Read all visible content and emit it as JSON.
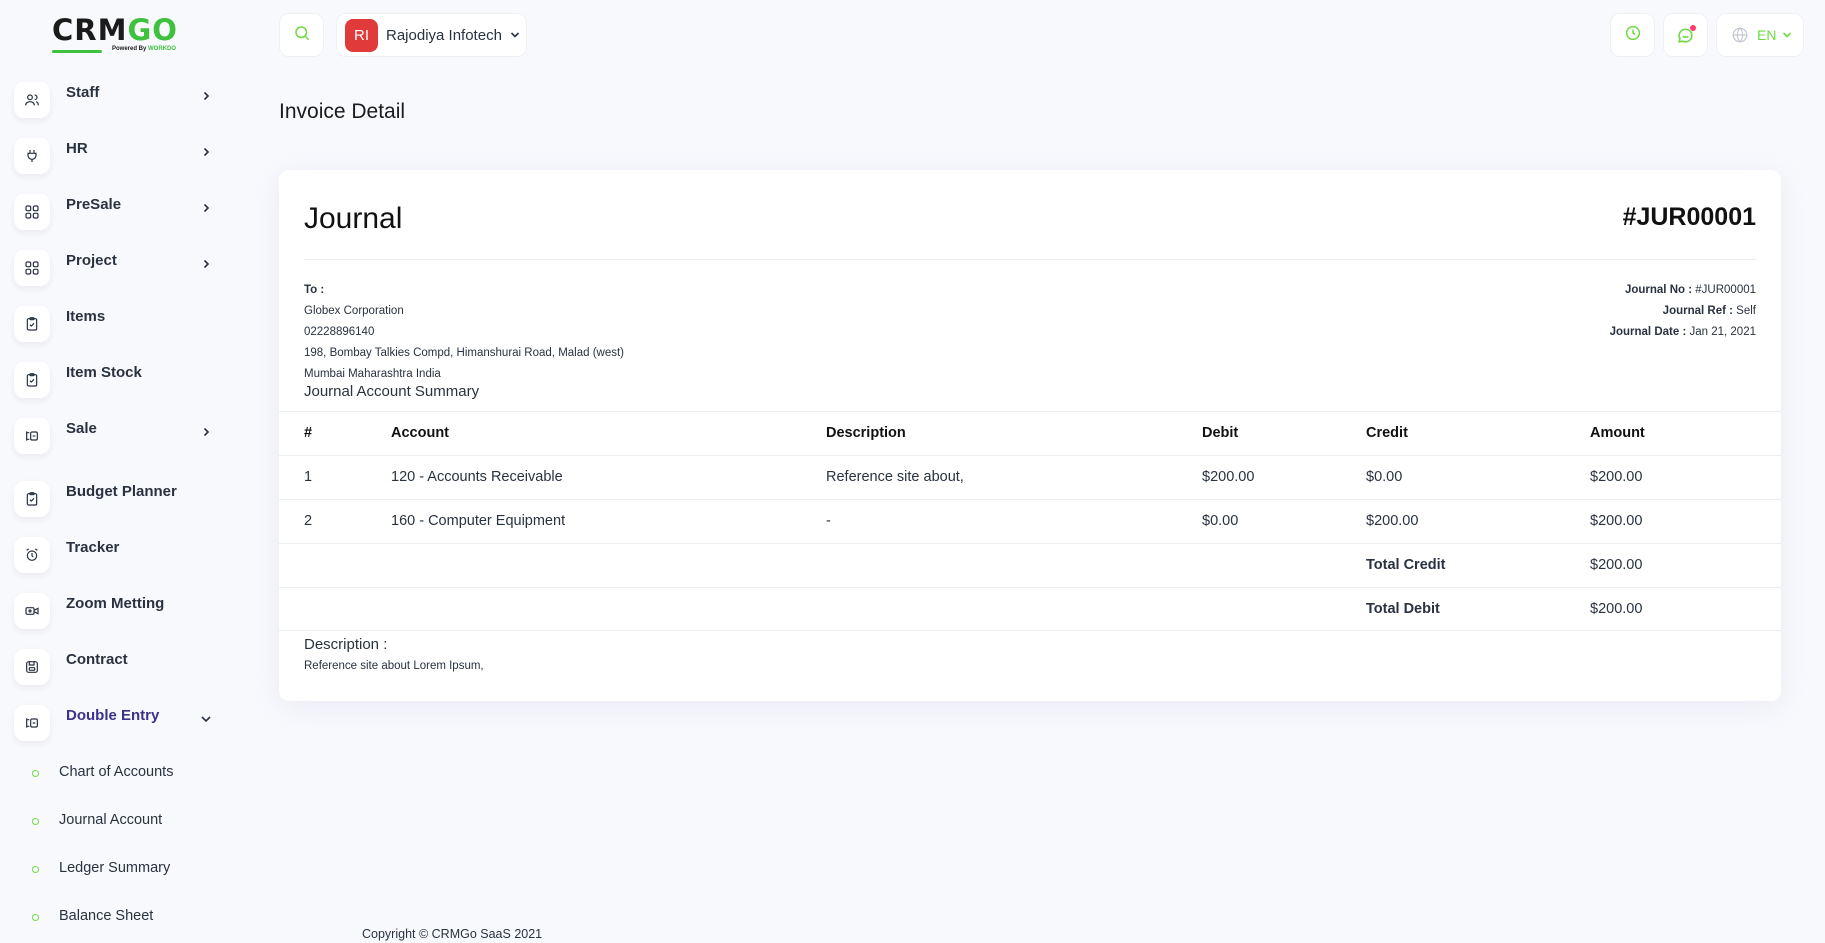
{
  "brand": {
    "logo_main": "CRMGO",
    "logo_sub": "Powered By WORKDO",
    "accent": "#6fd943",
    "primary": "#3a3388"
  },
  "sidebar": {
    "items": [
      {
        "label": "Staff",
        "icon": "users-icon",
        "has_arrow": true
      },
      {
        "label": "HR",
        "icon": "plug-icon",
        "has_arrow": true
      },
      {
        "label": "PreSale",
        "icon": "grid-icon",
        "has_arrow": true
      },
      {
        "label": "Project",
        "icon": "grid-icon",
        "has_arrow": true
      },
      {
        "label": "Items",
        "icon": "clipboard-icon",
        "has_arrow": false
      },
      {
        "label": "Item Stock",
        "icon": "clipboard-icon",
        "has_arrow": false
      },
      {
        "label": "Sale",
        "icon": "scale-icon",
        "has_arrow": true
      },
      {
        "label": "Budget Planner",
        "icon": "clipboard-icon",
        "has_arrow": false
      },
      {
        "label": "Tracker",
        "icon": "alarm-icon",
        "has_arrow": false
      },
      {
        "label": "Zoom Metting",
        "icon": "video-icon",
        "has_arrow": false
      },
      {
        "label": "Contract",
        "icon": "save-icon",
        "has_arrow": false
      },
      {
        "label": "Double Entry",
        "icon": "scale-icon",
        "has_arrow": true,
        "expanded": true,
        "active": true
      }
    ],
    "subitems": [
      {
        "label": "Chart of Accounts"
      },
      {
        "label": "Journal Account"
      },
      {
        "label": "Ledger Summary"
      },
      {
        "label": "Balance Sheet"
      }
    ]
  },
  "header": {
    "company_initials": "RI",
    "company_name": "Rajodiya Infotech",
    "language": "EN"
  },
  "page": {
    "title": "Invoice Detail"
  },
  "invoice": {
    "title": "Journal",
    "number": "#JUR00001",
    "to_label": "To :",
    "to_name": "Globex Corporation",
    "to_phone": "02228896140",
    "to_address": "198, Bombay Talkies Compd, Himanshurai Road, Malad (west)",
    "to_city": "Mumbai Maharashtra India",
    "journal_no_label": "Journal No :",
    "journal_no": "#JUR00001",
    "journal_ref_label": "Journal Ref :",
    "journal_ref": "Self",
    "journal_date_label": "Journal Date :",
    "journal_date": "Jan 21, 2021",
    "summary_title": "Journal Account Summary",
    "columns": [
      "#",
      "Account",
      "Description",
      "Debit",
      "Credit",
      "Amount"
    ],
    "rows": [
      {
        "num": "1",
        "account": "120 - Accounts Receivable",
        "description": "Reference site about,",
        "debit": "$200.00",
        "credit": "$0.00",
        "amount": "$200.00"
      },
      {
        "num": "2",
        "account": "160 - Computer Equipment",
        "description": "-",
        "debit": "$0.00",
        "credit": "$200.00",
        "amount": "$200.00"
      }
    ],
    "total_credit_label": "Total Credit",
    "total_credit": "$200.00",
    "total_debit_label": "Total Debit",
    "total_debit": "$200.00",
    "description_label": "Description :",
    "description_text": "Reference site about Lorem Ipsum,"
  },
  "footer": {
    "copyright": "Copyright © CRMGo SaaS 2021"
  }
}
